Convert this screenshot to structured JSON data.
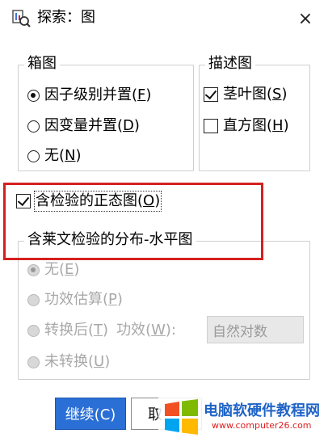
{
  "window": {
    "title": "探索：图",
    "close": "×"
  },
  "boxplot": {
    "legend": "箱图",
    "options": [
      {
        "label": "因子级别并置",
        "key": "F",
        "selected": true
      },
      {
        "label": "因变量并置",
        "key": "D",
        "selected": false
      },
      {
        "label": "无",
        "key": "N",
        "selected": false
      }
    ]
  },
  "descriptive": {
    "legend": "描述图",
    "options": [
      {
        "label": "茎叶图",
        "key": "S",
        "checked": true
      },
      {
        "label": "直方图",
        "key": "H",
        "checked": false
      }
    ]
  },
  "normality": {
    "label": "含检验的正态图",
    "key": "O",
    "checked": true
  },
  "levene": {
    "legend": "含莱文检验的分布-水平图",
    "options": [
      {
        "label": "无",
        "key": "E",
        "selected": true
      },
      {
        "label": "功效估算",
        "key": "P",
        "selected": false
      },
      {
        "label": "转换后",
        "key": "T",
        "selected": false,
        "power_label": "功效",
        "power_key": "W",
        "combo_value": "自然对数"
      },
      {
        "label": "未转换",
        "key": "U",
        "selected": false
      }
    ]
  },
  "buttons": {
    "continue": "继续(C)",
    "cancel": "取"
  },
  "watermark": {
    "title": "电脑软硬件教程网",
    "url": "www.computer26.com"
  },
  "colors": {
    "accent": "#2a6fd6",
    "highlight": "#d42020"
  }
}
